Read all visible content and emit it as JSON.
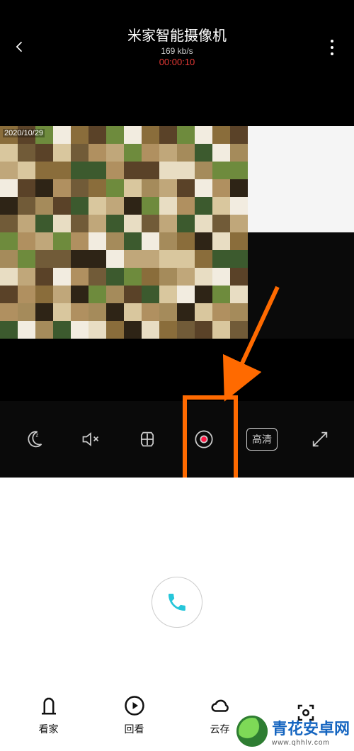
{
  "status": {
    "left": "",
    "right": ""
  },
  "header": {
    "title": "米家智能摄像机",
    "bitrate": "169 kb/s",
    "timer": "00:00:10"
  },
  "video": {
    "timestamp": "2020/10/29"
  },
  "toolbar": {
    "sleep_icon": "sleep-icon",
    "mute_icon": "mute-icon",
    "snapshot_icon": "snapshot-icon",
    "record_icon": "record-icon",
    "hd_label": "高清",
    "fullscreen_icon": "fullscreen-icon"
  },
  "call": {
    "label": "call"
  },
  "nav": [
    {
      "icon": "home-watch",
      "label": "看家"
    },
    {
      "icon": "playback",
      "label": "回看"
    },
    {
      "icon": "cloud",
      "label": "云存"
    },
    {
      "icon": "scan",
      "label": ""
    }
  ],
  "watermark": {
    "brand": "青花安卓网",
    "url": "www.qhhlv.com"
  }
}
